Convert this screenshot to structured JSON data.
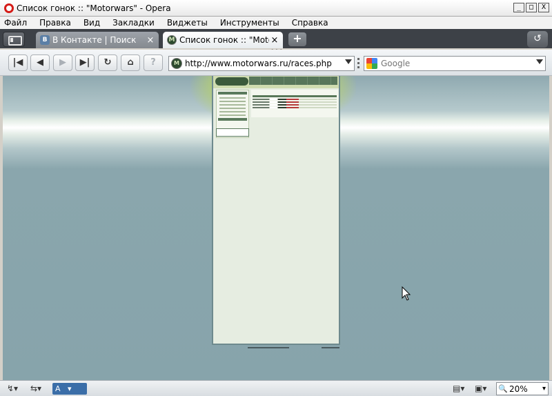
{
  "window": {
    "title": "Список гонок :: \"Motorwars\" - Opera",
    "buttons": {
      "minimize": "_",
      "maximize": "□",
      "close": "X"
    }
  },
  "menu": [
    "Файл",
    "Правка",
    "Вид",
    "Закладки",
    "Виджеты",
    "Инструменты",
    "Справка"
  ],
  "tabs": [
    {
      "favicon": "vk-icon",
      "favicon_text": "B",
      "label": "В Контакте | Поиск",
      "close": "×"
    },
    {
      "favicon": "motorwars-icon",
      "favicon_text": "M",
      "label": "Список гонок :: \"Motor...",
      "close": "×"
    }
  ],
  "tabbar": {
    "new_tab": "+",
    "trash": "↺"
  },
  "toolbar": {
    "rewind": "|◀",
    "back": "◀",
    "forward": "▶",
    "fast_forward": "▶|",
    "reload": "↻",
    "home": "⌂",
    "wand": "?",
    "address": "http://www.motorwars.ru/races.php",
    "address_favicon_text": "M",
    "search_engine": "Google"
  },
  "statusbar": {
    "left1": "↯▾",
    "left2": "⇆▾",
    "view_label": "A",
    "page_btn": "▤▾",
    "image_btn": "▣▾",
    "zoom_icon": "🔍",
    "zoom": "20%"
  },
  "colors": {
    "tabbar": "#3d4147",
    "opera_red": "#d51b17",
    "page_bg": "#87a4ab",
    "site_green": "#587759"
  }
}
